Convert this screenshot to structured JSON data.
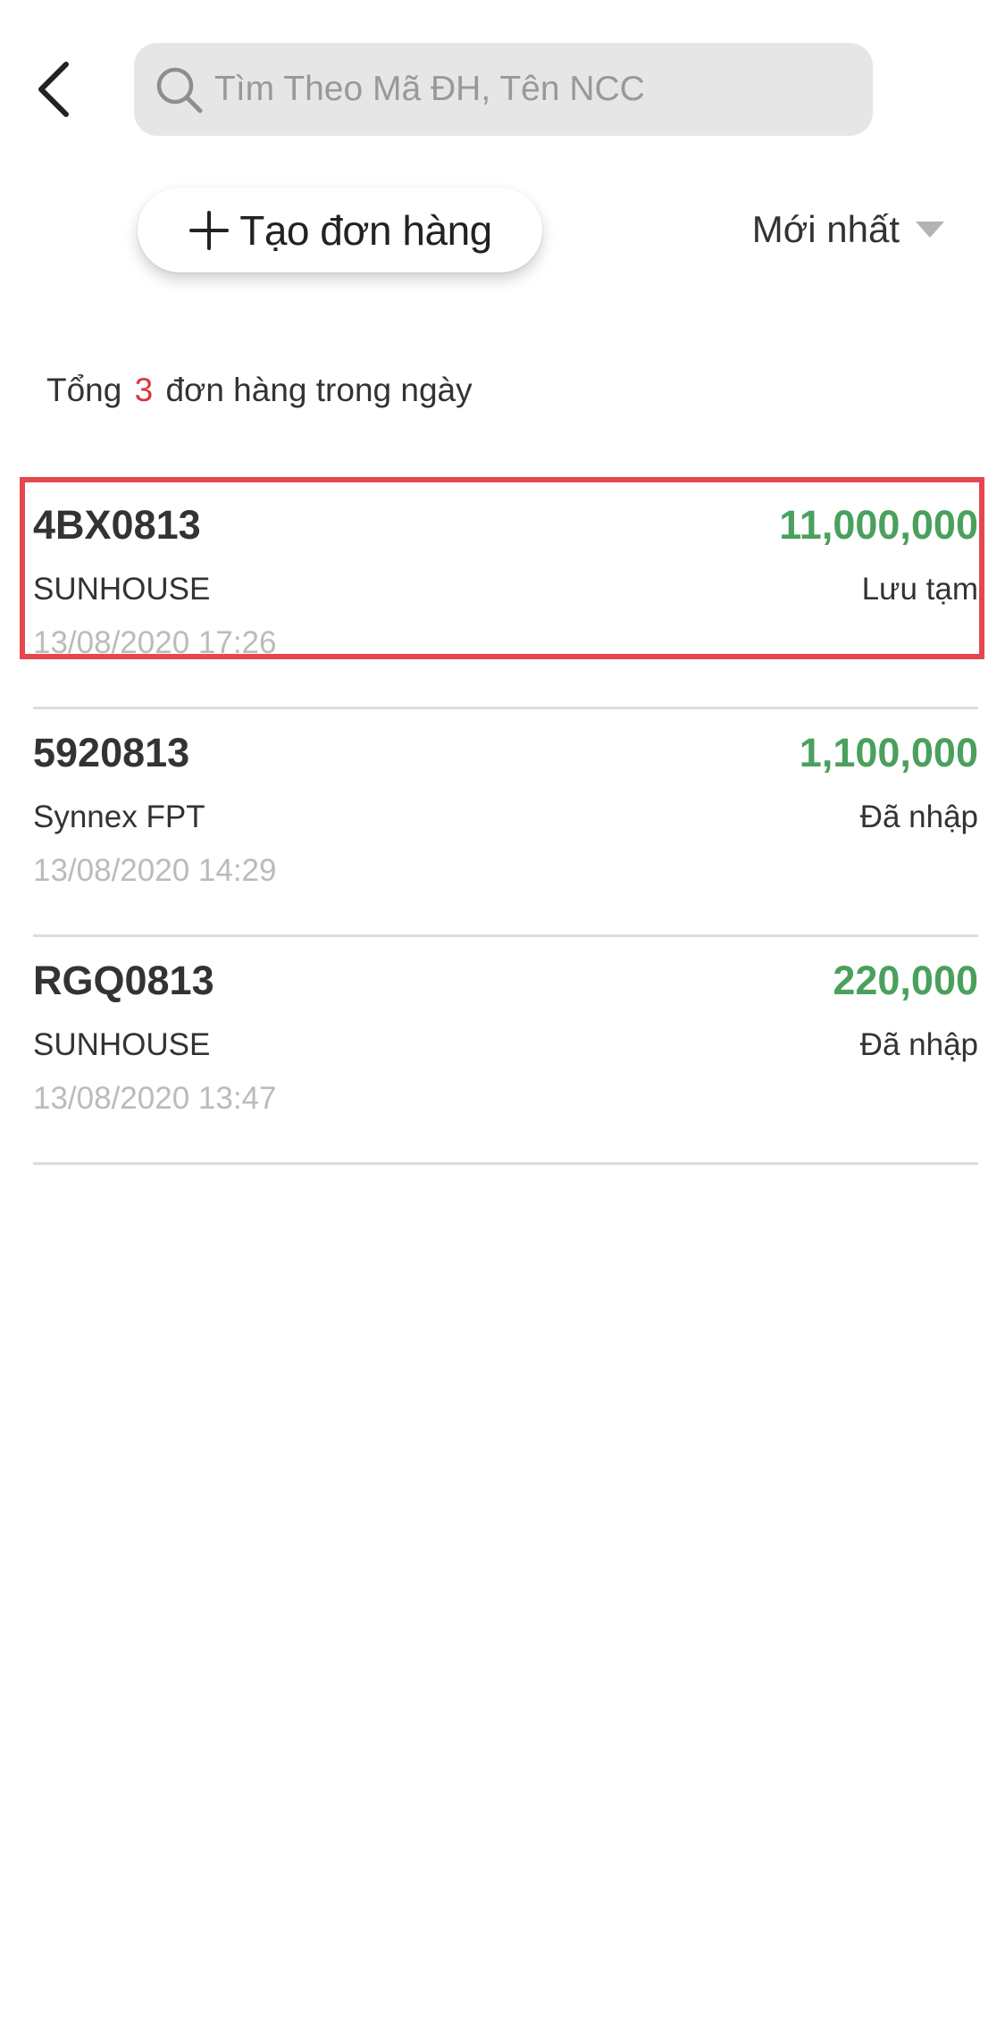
{
  "header": {
    "back_icon": "chevron-left-icon",
    "search": {
      "icon": "search-icon",
      "placeholder": "Tìm Theo Mã ĐH, Tên NCC",
      "value": ""
    }
  },
  "toolbar": {
    "create_icon": "plus-icon",
    "create_label": "Tạo đơn hàng",
    "sort_label": "Mới nhất",
    "sort_icon": "caret-down-icon"
  },
  "summary": {
    "prefix": "Tổng",
    "count": "3",
    "suffix": "đơn hàng trong ngày"
  },
  "orders": [
    {
      "code": "4BX0813",
      "amount": "11,000,000",
      "supplier": "SUNHOUSE",
      "status": "Lưu tạm",
      "time": "13/08/2020 17:26"
    },
    {
      "code": "5920813",
      "amount": "1,100,000",
      "supplier": "Synnex FPT",
      "status": "Đã nhập",
      "time": "13/08/2020 14:29"
    },
    {
      "code": "RGQ0813",
      "amount": "220,000",
      "supplier": "SUNHOUSE",
      "status": "Đã nhập",
      "time": "13/08/2020 13:47"
    }
  ],
  "colors": {
    "amount": "#4aa05c",
    "count_highlight": "#d9383a",
    "selection_outline": "#e6474f",
    "search_bg": "#e6e6e6"
  }
}
